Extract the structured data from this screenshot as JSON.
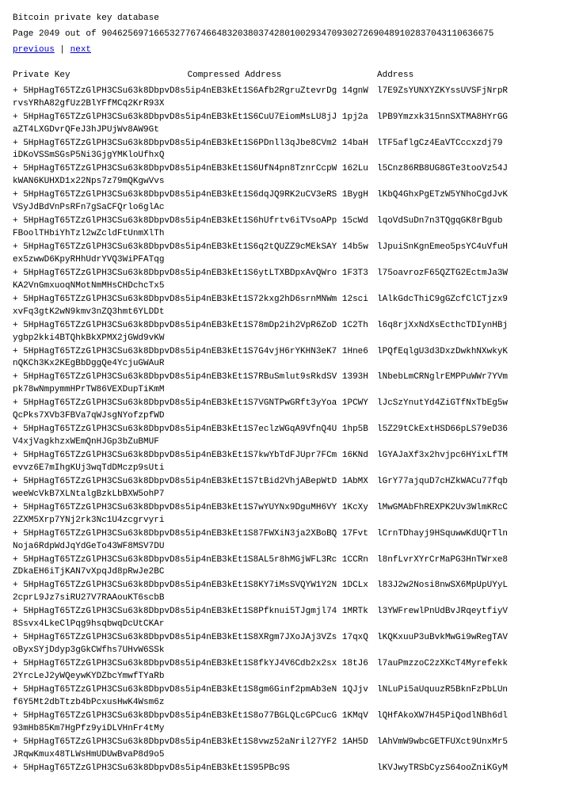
{
  "header": {
    "line1": "Bitcoin private key database",
    "line2": "Page 2049 out of 904625697166532776746648320380374280100293470930272690489102837",
    "line3": "043110636675",
    "nav": {
      "previous": "previous",
      "separator": " | ",
      "next": "next"
    }
  },
  "columns": {
    "private_key": "Private Key",
    "compressed_address": "Compressed Address",
    "address": "Address"
  },
  "rows": [
    {
      "key": "+ 5HpHagT65TZzGlPH3CSu63k8DbpvD8s5ip4nEB3kEt1S6Afb2RgruZtevrDg  14gnWrvsYRhA82gfUz2BlYFfMCq2KrR93X",
      "addr": "l7E9ZsYUNXYZKYssUVSFjNrpR"
    },
    {
      "key": "+ 5HpHagT65TZzGlPH3CSu63k8DbpvD8s5ip4nEB3kEt1S6CuU7EiomMsLU8jJ  1pj2aaZT4LXGDvrQFeJ3hJPUjWv8AW9Gt",
      "addr": "lPB9Ymzxk315nnSXTMA8HYrGG"
    },
    {
      "key": "+ 5HpHagT65TZzGlPH3CSu63k8DbpvD8s5ip4nEB3kEt1S6PDnll3qJbe8CVm2  14baHiDKoVSSmSGsP5Ni3GjgYMKloUfhxQ",
      "addr": "lTF5aflgCz4EaVTCccxzdj79"
    },
    {
      "key": "+ 5HpHagT65TZzGlPH3CSu63k8DbpvD8s5ip4nEB3kEt1S6UfN4pn8TznrCcpW  162LukWAN6KUHXD1x22Nps7z79mQKgwVvs",
      "addr": "l5Cnz86RB8UG8GTe3tooVz54J"
    },
    {
      "key": "+ 5HpHagT65TZzGlPH3CSu63k8DbpvD8s5ip4nEB3kEt1S6dqJQ9RK2uCV3eRS  1BygHVSyJdBdVnPsRFn7gSaCFQrlo6glAc",
      "addr": "lKbQ4GhxPgETzW5YNhoCgdJvK"
    },
    {
      "key": "+ 5HpHagT65TZzGlPH3CSu63k8DbpvD8s5ip4nEB3kEt1S6hUfrtv6iTVsoAPp  15cWdFBoolTHbiYhTzl2wZcldFtUnmXlTh",
      "addr": "lqoVdSuDn7n3TQgqGK8rBgub"
    },
    {
      "key": "+ 5HpHagT65TZzGlPH3CSu63k8DbpvD8s5ip4nEB3kEt1S6q2tQUZZ9cMEkSAY  14b5wex5zwwD6KpyRHhUdrYVQ3WiPFATqg",
      "addr": "lJpuiSnKgnEmeo5psYC4uVfuH"
    },
    {
      "key": "+ 5HpHagT65TZzGlPH3CSu63k8DbpvD8s5ip4nEB3kEt1S6ytLTXBDpxAvQWro  1F3T3KA2VnGmxuoqNMotNmMHsCHDchcTx5",
      "addr": "l75oavrozF65QZTG2EctmJa3W"
    },
    {
      "key": "+ 5HpHagT65TZzGlPH3CSu63k8DbpvD8s5ip4nEB3kEt1S72kxg2hD6srnMNWm  12scixvFq3gtK2wN9kmv3nZQ3hmt6YLDDt",
      "addr": "lAlkGdcThiC9gGZcfClCTjzx9"
    },
    {
      "key": "+ 5HpHagT65TZzGlPH3CSu63k8DbpvD8s5ip4nEB3kEt1S78mDp2ih2VpR6ZoD  1C2Thygbp2kki4BTQhkBkXPMX2jGWd9vKW",
      "addr": "l6q8rjXxNdXsEcthcTDIynHBj"
    },
    {
      "key": "+ 5HpHagT65TZzGlPH3CSu63k8DbpvD8s5ip4nEB3kEt1S7G4vjH6rYKHN3eK7  1Hne6nQKCh3Kx2KEgBbDggQe4YcjuGWAuR",
      "addr": "lPQfEqlgU3d3DxzDwkhNXwkyK"
    },
    {
      "key": "+ 5HpHagT65TZzGlPH3CSu63k8DbpvD8s5ip4nEB3kEt1S7RBuSmlut9sRkdSV  1393Hpk78wNmpymmHPrTW86VEXDupTiKmM",
      "addr": "lNbebLmCRNglrEMPPuWWr7YVm"
    },
    {
      "key": "+ 5HpHagT65TZzGlPH3CSu63k8DbpvD8s5ip4nEB3kEt1S7VGNTPwGRft3yYoa  1PCWYQcPks7XVb3FBVa7qWJsgNYofzpfWD",
      "addr": "lJcSzYnutYd4ZiGTfNxTbEg5w"
    },
    {
      "key": "+ 5HpHagT65TZzGlPH3CSu63k8DbpvD8s5ip4nEB3kEt1S7eclzWGqA9VfnQ4U  1hp5BV4xjVagkhzxWEmQnHJGp3bZuBMUF",
      "addr": "l5Z29tCkExtHSD66pLS79eD36"
    },
    {
      "key": "+ 5HpHagT65TZzGlPH3CSu63k8DbpvD8s5ip4nEB3kEt1S7kwYbTdFJUpr7FCm  16KNdevvz6E7mIhgKUj3wqTdDMczp9sUti",
      "addr": "lGYAJaXf3x2hvjpc6HYixLfTM"
    },
    {
      "key": "+ 5HpHagT65TZzGlPH3CSu63k8DbpvD8s5ip4nEB3kEt1S7tBid2VhjABepWtD  1AbMXweeWcVkB7XLNtalgBzkLbBXW5ohP7",
      "addr": "lGrY77ajquD7cHZkWACu77fqb"
    },
    {
      "key": "+ 5HpHagT65TZzGlPH3CSu63k8DbpvD8s5ip4nEB3kEt1S7wYUYNx9DguMH6VY  1KcXy2ZXM5Xrp7YNj2rk3Nc1U4zcgrvyri",
      "addr": "lMwGMAbFhREXPK2Uv3WlmKRcC"
    },
    {
      "key": "+ 5HpHagT65TZzGlPH3CSu63k8DbpvD8s5ip4nEB3kEt1S87FWXiN3ja2XBoBQ  17FvtNoja6RdpWdJqYdGeTo43WF8MSV7DU",
      "addr": "lCrnTDhayj9HSquwwKdUQrTln"
    },
    {
      "key": "+ 5HpHagT65TZzGlPH3CSu63k8DbpvD8s5ip4nEB3kEt1S8AL5r8hMGjWFL3Rc  1CCRnZDkaEH6iTjKAN7vXpqJd8pRwJe2BC",
      "addr": "l8nfLvrXYrCrMaPG3HnTWrxe8"
    },
    {
      "key": "+ 5HpHagT65TZzGlPH3CSu63k8DbpvD8s5ip4nEB3kEt1S8KY7iMsSVQYW1Y2N  1DCLx2cprL9Jz7siRU27V7RAAouKT6scbB",
      "addr": "l83J2w2Nosi8nwSX6MpUpUYyL"
    },
    {
      "key": "+ 5HpHagT65TZzGlPH3CSu63k8DbpvD8s5ip4nEB3kEt1S8Pfknui5TJgmjl74  1MRTk8Ssvx4LkeClPqg9hsqbwqDcUtCKAr",
      "addr": "l3YWFrewlPnUdBvJRqeytfiyV"
    },
    {
      "key": "+ 5HpHagT65TZzGlPH3CSu63k8DbpvD8s5ip4nEB3kEt1S8XRgm7JXoJAj3VZs  17qxQoByxSYjDdyp3gGkCWfhs7UHvW6SSk",
      "addr": "lKQKxuuP3uBvkMwGi9wRegTAV"
    },
    {
      "key": "+ 5HpHagT65TZzGlPH3CSu63k8DbpvD8s5ip4nEB3kEt1S8fkYJ4V6Cdb2x2sx  18tJ62YrcLeJ2yWQeywKYDZbcYmwfTYaRb",
      "addr": "l7auPmzzoC2zXKcT4Myrefekk"
    },
    {
      "key": "+ 5HpHagT65TZzGlPH3CSu63k8DbpvD8s5ip4nEB3kEt1S8gm6Ginf2pmAb3eN  1QJjvf6Y5Mt2dbTtzb4bPcxusHwK4Wsm6z",
      "addr": "lNLuPi5aUquuzR5BknFzPbLUn"
    },
    {
      "key": "+ 5HpHagT65TZzGlPH3CSu63k8DbpvD8s5ip4nEB3kEt1S8o77BGLQLcGPCucG  1KMqV93mHb85Km7HgPfz9yiDLVHnFr4tMy",
      "addr": "lQHfAkoXW7H45PiQodlNBh6dl"
    },
    {
      "key": "+ 5HpHagT65TZzGlPH3CSu63k8DbpvD8s5ip4nEB3kEt1S8vwz52aNril27YF2  1AH5DJRqwKmux48TLWsHmUDUwBvaP8d9o5",
      "addr": "lAhVmW9wbcGETFUXct9UnxMr5"
    },
    {
      "key": "+ 5HpHagT65TZzGlPH3CSu63k8DbpvD8s5ip4nEB3kEt1S95PBc9S",
      "addr": "lKVJwyTRSbCyzS64ooZniKGyM"
    }
  ]
}
